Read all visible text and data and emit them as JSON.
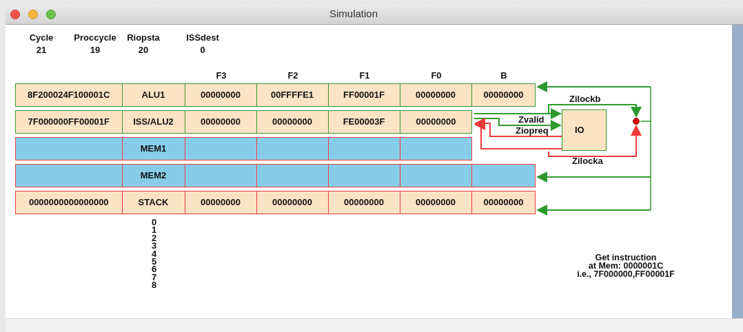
{
  "window": {
    "title": "Simulation"
  },
  "stats": [
    {
      "label": "Cycle",
      "value": "21"
    },
    {
      "label": "Proccycle",
      "value": "19"
    },
    {
      "label": "Riopsta",
      "value": "20"
    },
    {
      "label": "ISSdest",
      "value": "0"
    }
  ],
  "columns": [
    "F3",
    "F2",
    "F1",
    "F0",
    "B"
  ],
  "stages": [
    {
      "color": "#2e9a2e",
      "empty": false,
      "cells": [
        "8F200024F100001C",
        "ALU1",
        "00000000",
        "00FFFFE1",
        "FF00001F",
        "00000000",
        "00000000"
      ]
    },
    {
      "color": "#2e9a2e",
      "empty": false,
      "cells": [
        "7F000000FF00001F",
        "ISS/ALU2",
        "00000000",
        "00000000",
        "FE00003F",
        "00000000"
      ]
    },
    {
      "color": "#f03a3a",
      "empty": true,
      "cells": [
        null,
        "MEM1",
        null,
        null,
        null,
        null
      ]
    },
    {
      "color": "#f03a3a",
      "empty": true,
      "cells": [
        null,
        "MEM2",
        null,
        null,
        null,
        null,
        null
      ]
    },
    {
      "color": "#f03a3a",
      "empty": false,
      "cells": [
        "0000000000000000",
        "STACK",
        "00000000",
        "00000000",
        "00000000",
        "00000000",
        "00000000"
      ]
    }
  ],
  "stack_indices": [
    "0",
    "1",
    "2",
    "3",
    "4",
    "5",
    "6",
    "7",
    "8"
  ],
  "io_unit": {
    "label": "IO"
  },
  "signals": [
    {
      "label": "Zilockb",
      "color": "#2e9a2e"
    },
    {
      "label": "Zvalid",
      "color": "#2e9a2e"
    },
    {
      "label": "Ziopreq",
      "color": "#f03a3a"
    },
    {
      "label": "Zilocka",
      "color": "#f03a3a"
    }
  ],
  "message": [
    "Get instruction",
    "at Mem: 0000001C",
    "i.e., 7F000000,FF00001F"
  ]
}
